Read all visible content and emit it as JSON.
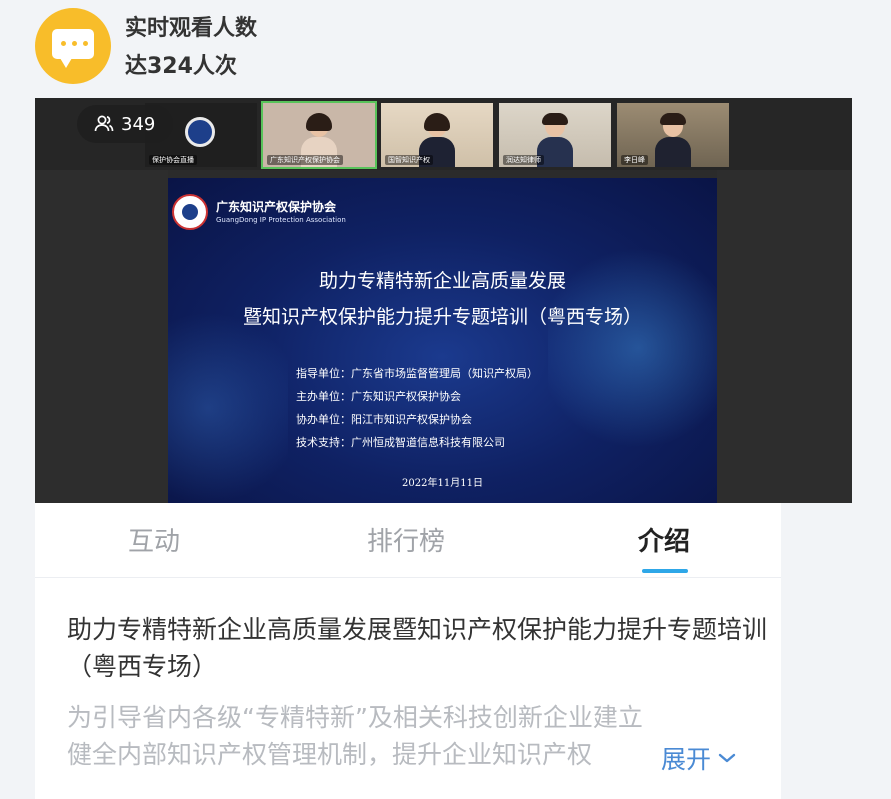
{
  "chat": {
    "line1": "实时观看人数",
    "line2": "达324人次"
  },
  "video": {
    "viewer_count": "349",
    "participants": [
      {
        "label": "保护协会直播"
      },
      {
        "label": "广东知识产权保护协会"
      },
      {
        "label": "国智知识产权"
      },
      {
        "label": "润达知律师"
      },
      {
        "label": "李日峰"
      }
    ],
    "slide": {
      "org_name_cn": "广东知识产权保护协会",
      "org_name_en": "GuangDong IP Protection Association",
      "title_line1": "助力专精特新企业高质量发展",
      "title_line2": "暨知识产权保护能力提升专题培训（粤西专场）",
      "org_lines": [
        "指导单位：广东省市场监督管理局（知识产权局）",
        "主办单位：广东知识产权保护协会",
        "协办单位：阳江市知识产权保护协会",
        "技术支持：广州恒成智道信息科技有限公司"
      ],
      "date": "2022年11月11日"
    }
  },
  "tabs": [
    {
      "label": "互动"
    },
    {
      "label": "排行榜"
    },
    {
      "label": "介绍"
    }
  ],
  "intro": {
    "title": "助力专精特新企业高质量发展暨知识产权保护能力提升专题培训（粤西专场）",
    "body_line1": "为引导省内各级“专精特新”及相关科技创新企业建立",
    "body_line2": "健全内部知识产权管理机制，提升企业知识产权",
    "expand_label": "展开"
  },
  "colors": {
    "avatar_bg": "#f8bd2a",
    "tab_accent": "#2ea7e8",
    "expand_link": "#4a8ad4"
  },
  "icons": {
    "avatar": "chat-bubble-icon",
    "viewers": "people-icon",
    "expand": "chevron-down-icon"
  }
}
